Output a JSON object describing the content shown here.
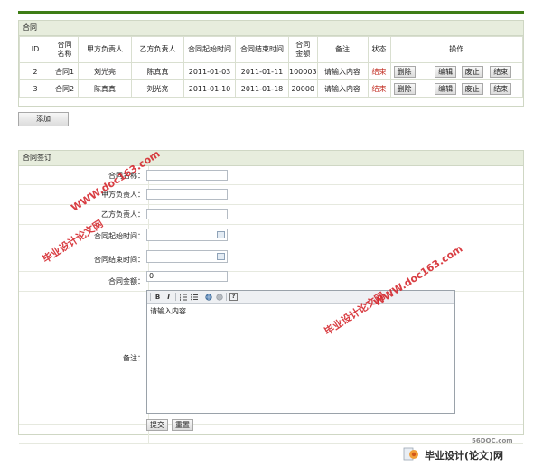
{
  "contract_list": {
    "title": "合同",
    "headers": [
      "ID",
      "合同名称",
      "甲方负责人",
      "乙方负责人",
      "合同起始时间",
      "合同结束时间",
      "合同金额",
      "备注",
      "状态",
      "操作"
    ],
    "rows": [
      {
        "id": "2",
        "name": "合同1",
        "party_a": "刘光亮",
        "party_b": "陈真真",
        "start": "2011-01-03",
        "end": "2011-01-11",
        "amount": "100003",
        "remark": "请输入内容",
        "status": "结束"
      },
      {
        "id": "3",
        "name": "合同2",
        "party_a": "陈真真",
        "party_b": "刘光亮",
        "start": "2011-01-10",
        "end": "2011-01-18",
        "amount": "20000",
        "remark": "请输入内容",
        "status": "结束"
      }
    ],
    "actions": {
      "delete": "删除",
      "edit": "编辑",
      "void": "废止",
      "finish": "结束"
    },
    "add_label": "添加"
  },
  "sign_form": {
    "title": "合同签订",
    "labels": {
      "name": "合同名称：",
      "party_a": "甲方负责人：",
      "party_b": "乙方负责人：",
      "start": "合同起始时间：",
      "end": "合同结束时间：",
      "amount": "合同金额：",
      "remark": "备注："
    },
    "amount_value": "0",
    "editor_content": "请输入内容",
    "submit_label": "提交",
    "reset_label": "重置"
  },
  "watermarks": {
    "url": "WWW.doc163.com",
    "brand": "毕业设计论文网"
  },
  "footer": {
    "site": "56DOC.com",
    "brand": "毕业设计(论文)网"
  },
  "colors": {
    "accent": "#3e7d15",
    "status": "#c0281d",
    "watermark": "#d4242a"
  }
}
